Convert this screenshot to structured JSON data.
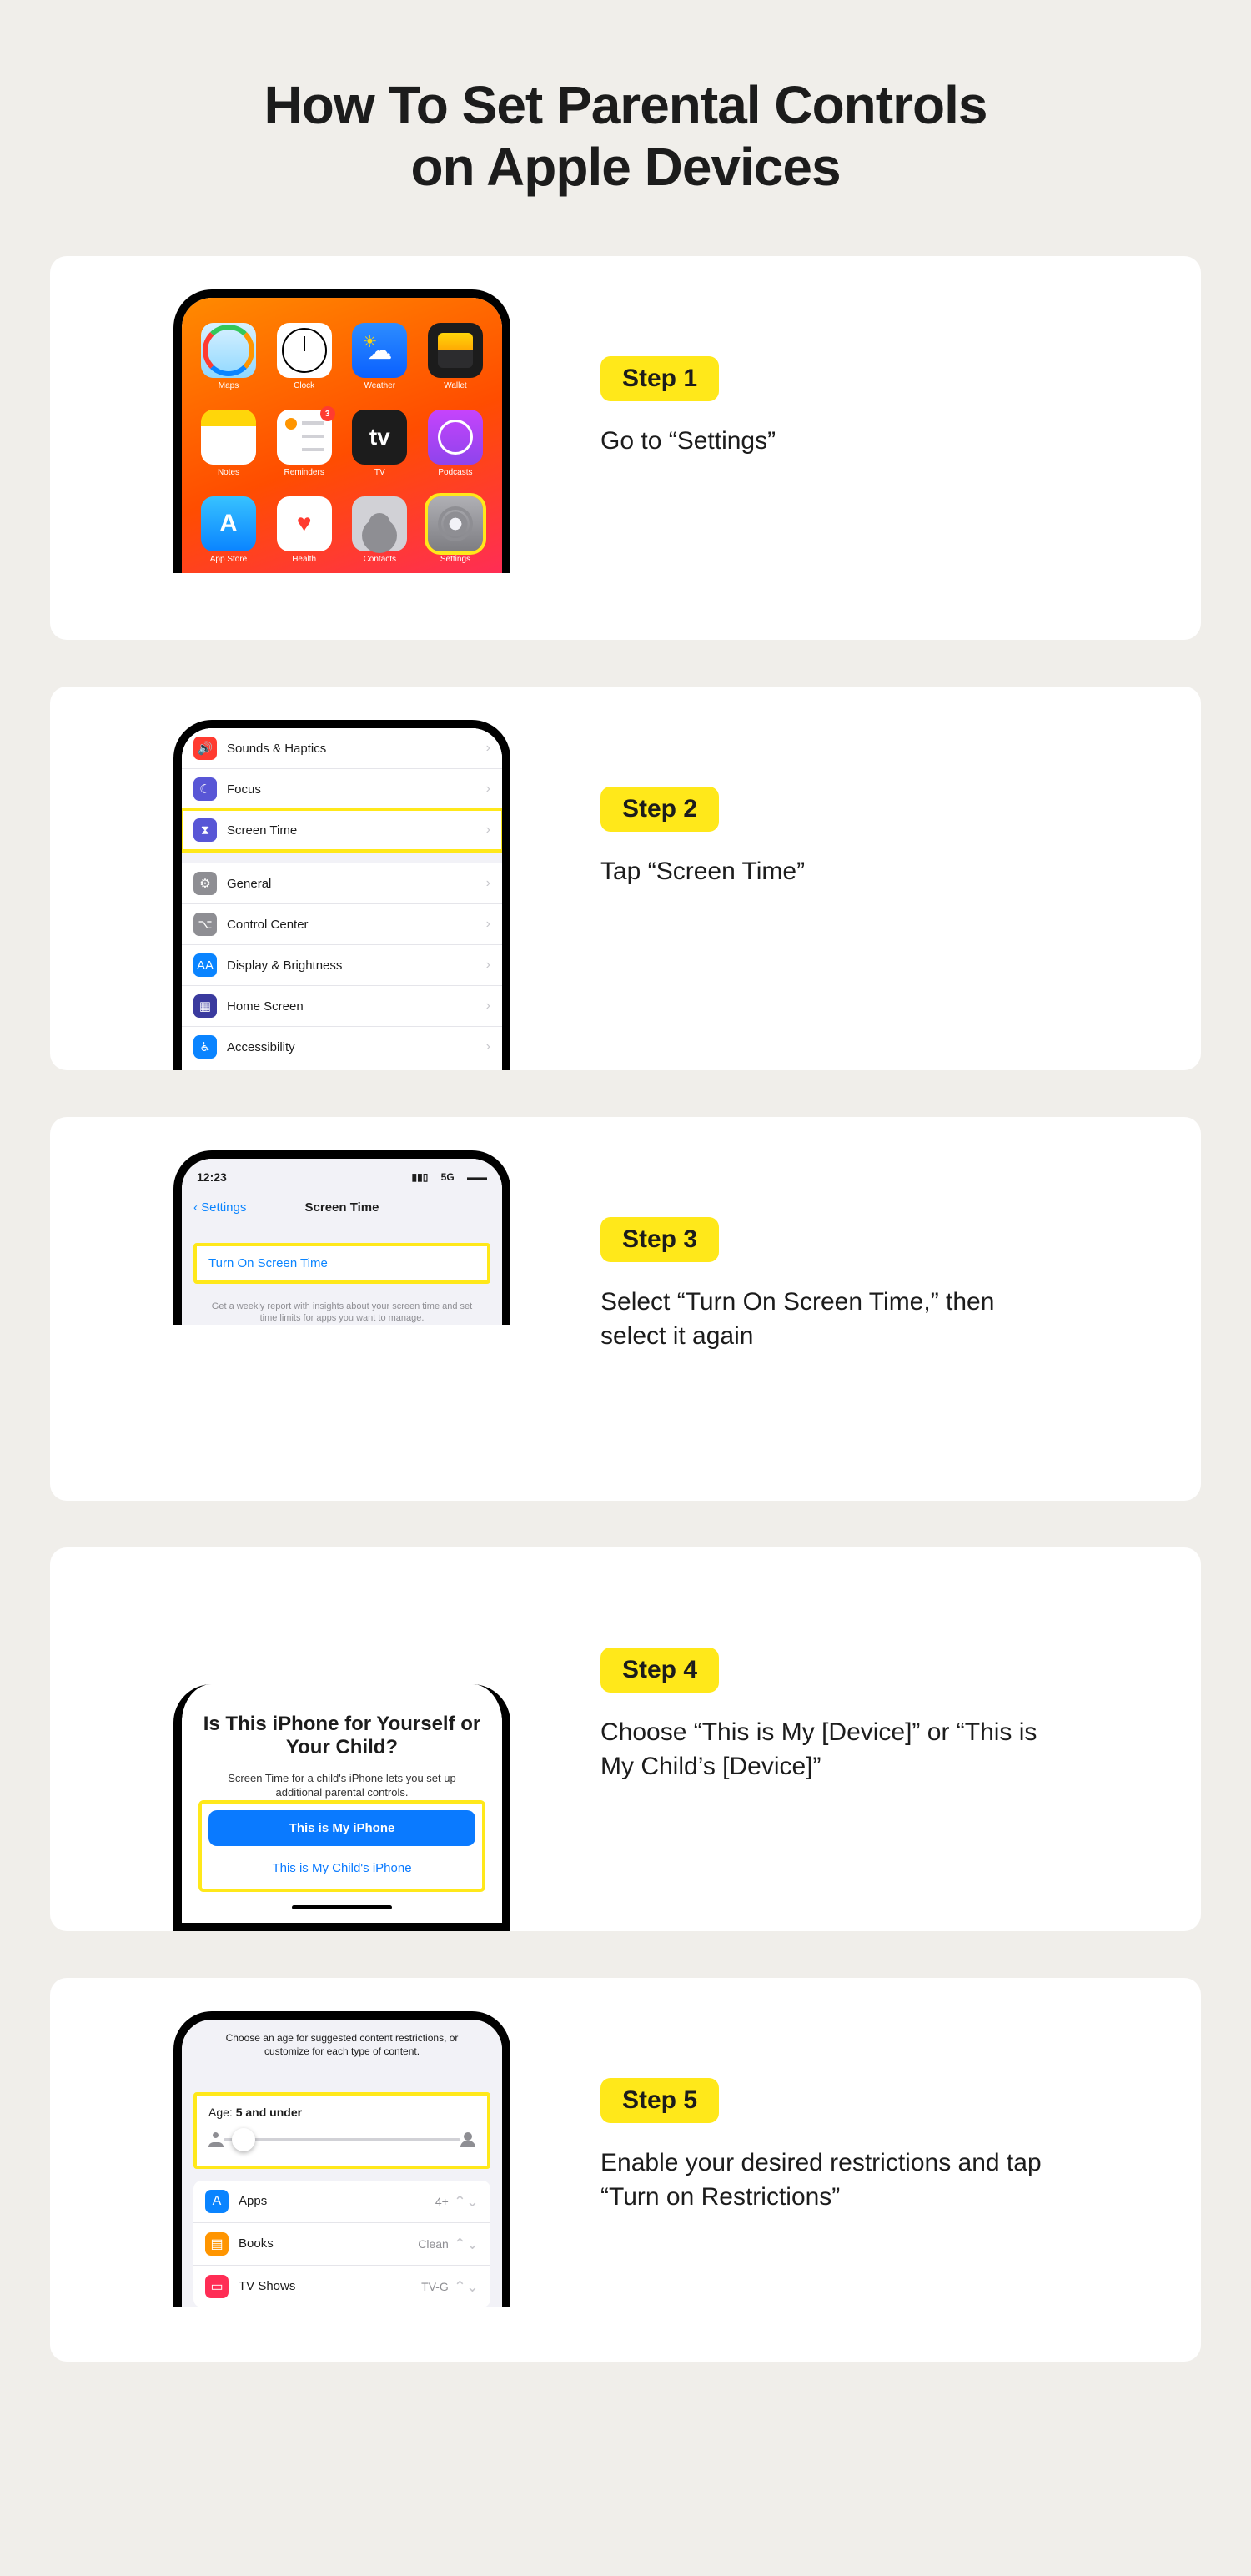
{
  "title_line1": "How To Set Parental Controls",
  "title_line2": "on Apple Devices",
  "steps": [
    {
      "badge": "Step 1",
      "desc": "Go to “Settings”"
    },
    {
      "badge": "Step 2",
      "desc": "Tap “Screen Time”"
    },
    {
      "badge": "Step 3",
      "desc": "Select “Turn On Screen Time,” then select it again"
    },
    {
      "badge": "Step 4",
      "desc": "Choose “This is My [Device]” or “This is My Child’s [Device]”"
    },
    {
      "badge": "Step 5",
      "desc": "Enable your desired restrictions and tap “Turn on Restrictions”"
    }
  ],
  "home_apps": [
    {
      "label": "Maps"
    },
    {
      "label": "Clock"
    },
    {
      "label": "Weather"
    },
    {
      "label": "Wallet"
    },
    {
      "label": "Notes"
    },
    {
      "label": "Reminders",
      "badge": "3"
    },
    {
      "label": "TV"
    },
    {
      "label": "Podcasts"
    },
    {
      "label": "App Store"
    },
    {
      "label": "Health"
    },
    {
      "label": "Contacts"
    },
    {
      "label": "Settings"
    }
  ],
  "settings_rows_a": [
    {
      "label": "Sounds & Haptics"
    },
    {
      "label": "Focus"
    },
    {
      "label": "Screen Time"
    }
  ],
  "settings_rows_b": [
    {
      "label": "General"
    },
    {
      "label": "Control Center"
    },
    {
      "label": "Display & Brightness"
    },
    {
      "label": "Home Screen"
    },
    {
      "label": "Accessibility"
    }
  ],
  "screen_time": {
    "clock": "12:23",
    "carrier": "5G",
    "back": "Settings",
    "title": "Screen Time",
    "turn_on": "Turn On Screen Time",
    "footer": "Get a weekly report with insights about your screen time and set time limits for apps you want to manage."
  },
  "owner": {
    "heading": "Is This iPhone for Yourself or Your Child?",
    "sub": "Screen Time for a child's iPhone lets you set up additional parental controls.",
    "primary": "This is My iPhone",
    "secondary": "This is My Child's iPhone"
  },
  "age": {
    "top": "Choose an age for suggested content restrictions, or customize for each type of content.",
    "label_prefix": "Age: ",
    "label_value": "5 and under",
    "rows": [
      {
        "label": "Apps",
        "value": "4+"
      },
      {
        "label": "Books",
        "value": "Clean"
      },
      {
        "label": "TV Shows",
        "value": "TV-G"
      }
    ]
  }
}
